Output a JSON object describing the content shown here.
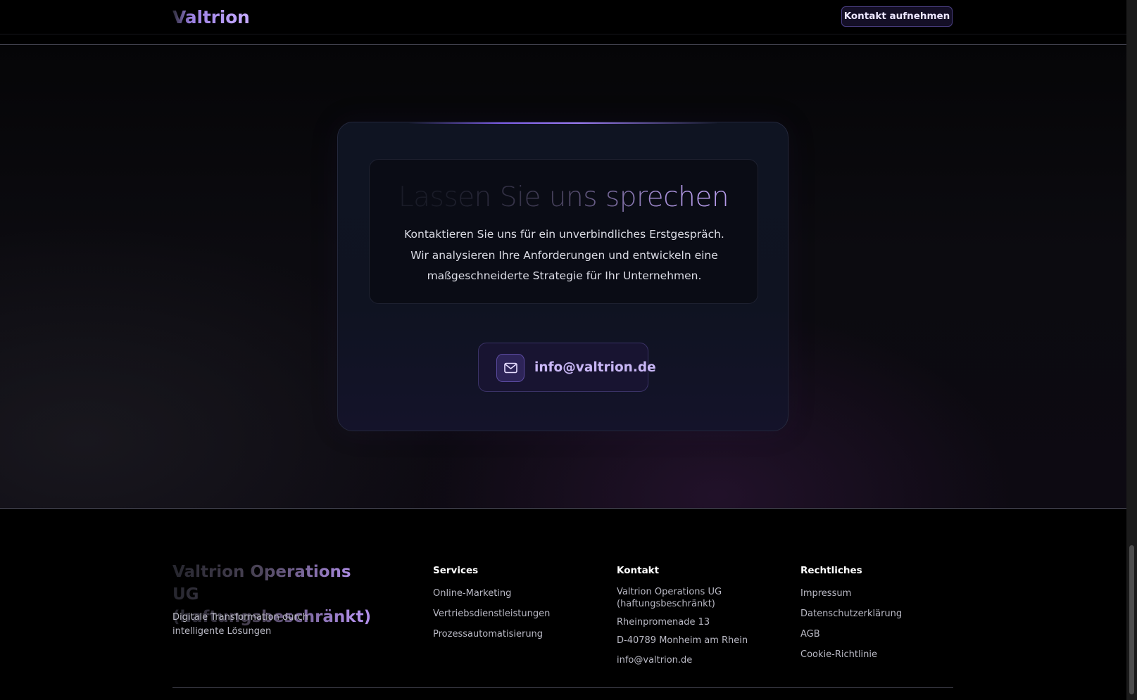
{
  "header": {
    "logo": "Valtrion",
    "cta_label": "Kontakt aufnehmen"
  },
  "contact": {
    "headline": "Lassen Sie uns sprechen",
    "description": "Kontaktieren Sie uns für ein unverbindliches Erstgespräch. Wir analysieren Ihre Anforderungen und entwickeln eine maßgeschneiderte Strategie für Ihr Unternehmen.",
    "email": "info@valtrion.de",
    "email_icon": "mail-icon"
  },
  "footer": {
    "brand": "Valtrion Operations UG (haftungsbeschränkt)",
    "tagline": "Digitale Transformation durch intelligente Lösungen",
    "services": {
      "heading": "Services",
      "items": [
        "Online-Marketing",
        "Vertriebsdienstleistungen",
        "Prozessautomatisierung"
      ]
    },
    "kontakt": {
      "heading": "Kontakt",
      "company": "Valtrion Operations UG (haftungsbeschränkt)",
      "street": "Rheinpromenade 13",
      "city": "D-40789 Monheim am Rhein",
      "email": "info@valtrion.de"
    },
    "legal": {
      "heading": "Rechtliches",
      "items": [
        "Impressum",
        "Datenschutzerklärung",
        "AGB",
        "Cookie-Richtlinie"
      ]
    }
  },
  "colors": {
    "accent": "#9d7cf5",
    "email_text": "#c8b6f5",
    "background": "#000000",
    "card": "#0f1422"
  }
}
